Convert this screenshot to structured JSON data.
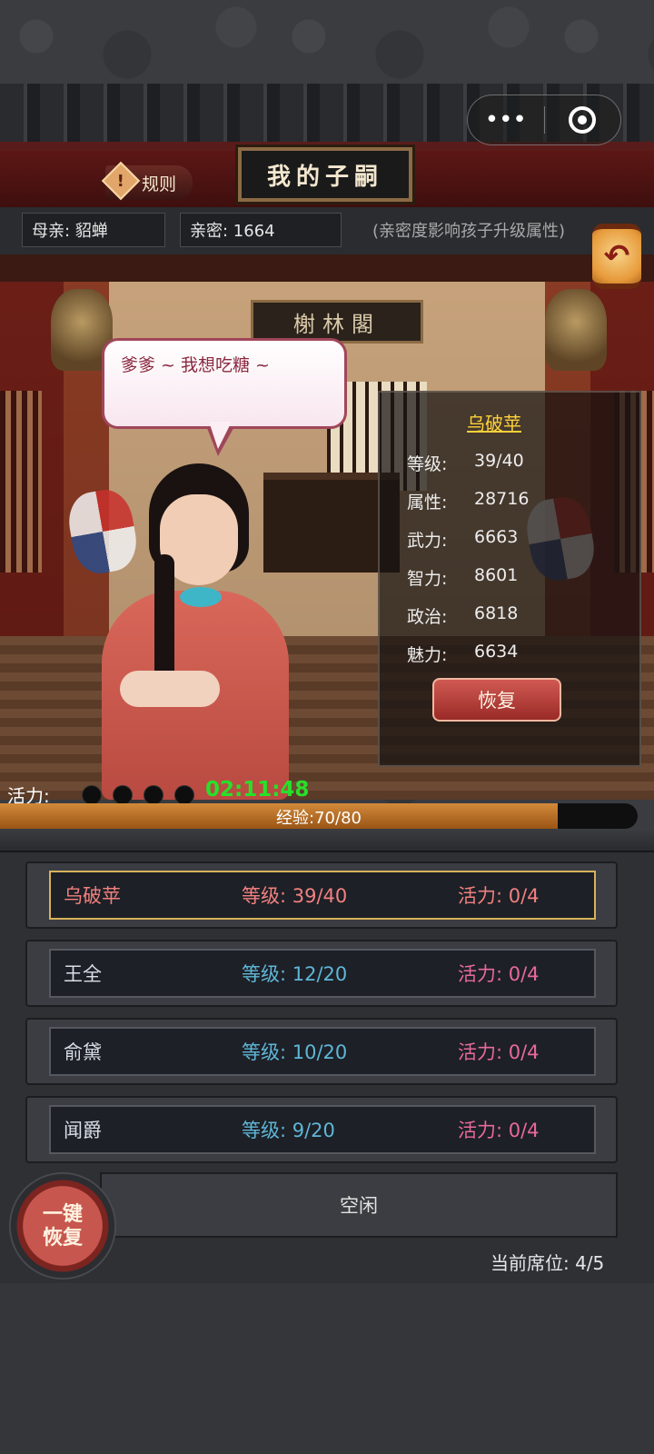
{
  "header": {
    "capsule_more": "•••",
    "rules_label": "规则",
    "title": "我的子嗣"
  },
  "info": {
    "mother": "母亲:  貂蝉",
    "intimacy": "亲密:   1664",
    "note": "(亲密度影响孩子升级属性)"
  },
  "scene": {
    "plaque": "榭林閣",
    "speech": "爹爹 ~ 我想吃糖 ~"
  },
  "child": {
    "name": "乌破苹",
    "stats": [
      {
        "label": "等级:",
        "value": "39/40"
      },
      {
        "label": "属性:",
        "value": "28716"
      },
      {
        "label": "武力:",
        "value": "6663"
      },
      {
        "label": "智力:",
        "value": "8601"
      },
      {
        "label": "政治:",
        "value": "6818"
      },
      {
        "label": "魅力:",
        "value": "6634"
      }
    ],
    "restore_label": "恢复"
  },
  "vitality": {
    "label": "活力:",
    "timer": "02:11:48",
    "filled": 0,
    "max": 4
  },
  "experience": {
    "label": "经验:70/80",
    "current": 70,
    "max": 80
  },
  "children_list": [
    {
      "name": "乌破苹",
      "level": "等级: 39/40",
      "vitality": "活力: 0/4",
      "selected": true
    },
    {
      "name": "王全",
      "level": "等级: 12/20",
      "vitality": "活力: 0/4",
      "selected": false
    },
    {
      "name": "俞黛",
      "level": "等级: 10/20",
      "vitality": "活力: 0/4",
      "selected": false
    },
    {
      "name": "闻爵",
      "level": "等级: 9/20",
      "vitality": "活力: 0/4",
      "selected": false
    }
  ],
  "empty_slot_label": "空闲",
  "one_key_restore_label": "一键恢复",
  "seat_label": "当前席位: 4/5",
  "colors": {
    "timer": "#27e02a",
    "child_name": "#ffd23a",
    "selected_row": "#f28080",
    "level_text": "#5fb6d8",
    "vitality_text": "#e8699b"
  }
}
